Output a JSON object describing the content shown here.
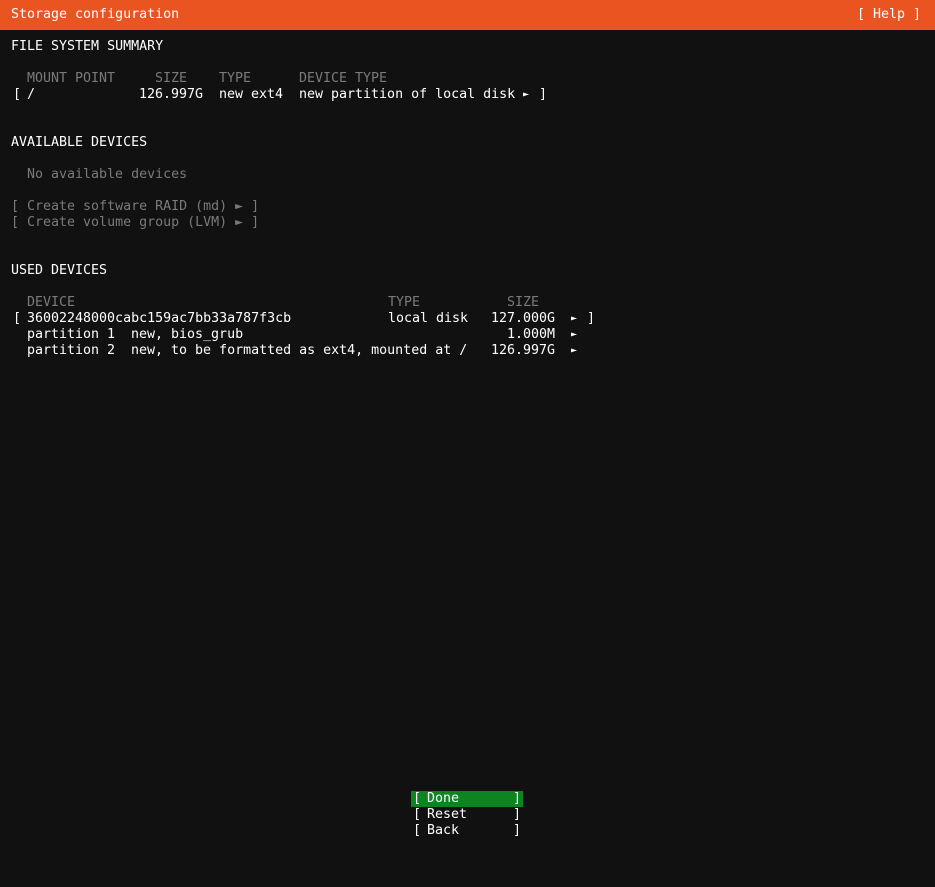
{
  "header": {
    "title": "Storage configuration",
    "help": "[ Help ]"
  },
  "fs_summary": {
    "heading": "FILE SYSTEM SUMMARY",
    "columns": {
      "mount": "MOUNT POINT",
      "size": "SIZE",
      "type": "TYPE",
      "device_type": "DEVICE TYPE"
    },
    "rows": [
      {
        "open": "[",
        "mount": "/",
        "size": "126.997G",
        "type": "new ext4",
        "device_type": "new partition of local disk",
        "arrow": "►",
        "close": "]"
      }
    ]
  },
  "available": {
    "heading": "AVAILABLE DEVICES",
    "empty": "No available devices",
    "raid": "[ Create software RAID (md) ► ]",
    "lvm": "[ Create volume group (LVM) ► ]"
  },
  "used": {
    "heading": "USED DEVICES",
    "columns": {
      "device": "DEVICE",
      "type": "TYPE",
      "size": "SIZE"
    },
    "disk": {
      "open": "[",
      "device": "36002248000cabc159ac7bb33a787f3cb",
      "type": "local disk",
      "size": "127.000G",
      "arrow": "►",
      "close": "]"
    },
    "partitions": [
      {
        "name": "partition 1",
        "desc": "new, bios_grub",
        "size": "1.000M",
        "arrow": "►"
      },
      {
        "name": "partition 2",
        "desc": "new, to be formatted as ext4, mounted at /",
        "size": "126.997G",
        "arrow": "►"
      }
    ]
  },
  "buttons": {
    "open": "[",
    "close": "]",
    "done": "Done",
    "reset": "Reset",
    "back": "Back"
  },
  "colors": {
    "accent": "#e95420",
    "active_button": "#0e8420",
    "background": "#111111",
    "dim_text": "#7a7a7a"
  }
}
